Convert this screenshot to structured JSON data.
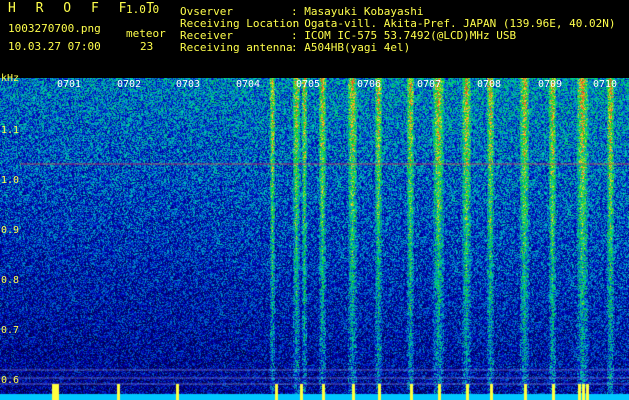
{
  "app": {
    "name": "H R O F F T",
    "version": "1.0.0",
    "filename": "1003270700.png",
    "timestamp": "10.03.27 07:00",
    "meteor_label": "meteor",
    "meteor_count": "23"
  },
  "station": {
    "observer_label": "Ovserver",
    "observer_value": ": Masayuki Kobayashi",
    "location_label": "Receiving Location",
    "location_value": ": Ogata-vill. Akita-Pref. JAPAN (139.96E, 40.02N)",
    "receiver_label": "Receiver",
    "receiver_value": ": ICOM IC-575 53.7492(@LCD)MHz USB",
    "antenna_label": "Receiving antenna",
    "antenna_value": ": A504HB(yagi 4el)"
  },
  "axis": {
    "y_unit": "kHz",
    "y_ticks": [
      "1.1",
      "1.0",
      "0.9",
      "0.8",
      "0.7",
      "0.6"
    ],
    "x_ticks": [
      "0701",
      "0702",
      "0703",
      "0704",
      "0705",
      "0706",
      "0707",
      "0708",
      "0709",
      "0710"
    ]
  },
  "colors": {
    "text": "#ffff4c",
    "tick_text": "#ffffff",
    "background": "#000000",
    "reference_line": "#ff4040"
  }
}
